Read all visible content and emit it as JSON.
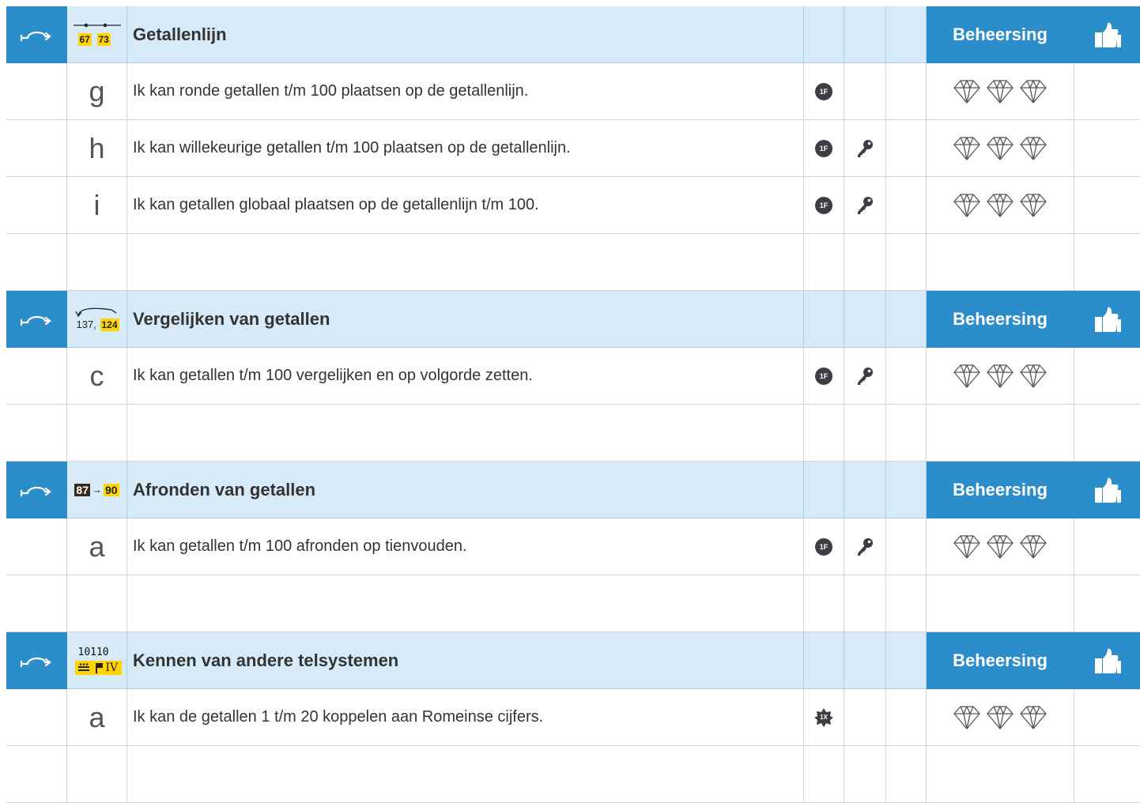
{
  "sections": [
    {
      "title": "Getallenlijn",
      "icon": "number-line-icon",
      "icon_numbers": [
        "67",
        "73"
      ],
      "mastery_label": "Beheersing",
      "rows": [
        {
          "letter": "g",
          "text": "Ik kan ronde getallen t/m 100 plaatsen op de getallenlijn.",
          "badge": "1F",
          "badge_type": "circle",
          "key": false
        },
        {
          "letter": "h",
          "text": "Ik kan willekeurige getallen t/m 100 plaatsen op de getallenlijn.",
          "badge": "1F",
          "badge_type": "circle",
          "key": true
        },
        {
          "letter": "i",
          "text": "Ik kan getallen globaal plaatsen op de getallenlijn t/m 100.",
          "badge": "1F",
          "badge_type": "circle",
          "key": true
        }
      ]
    },
    {
      "title": "Vergelijken van getallen",
      "icon": "compare-numbers-icon",
      "icon_numbers": [
        "137,",
        "124"
      ],
      "mastery_label": "Beheersing",
      "rows": [
        {
          "letter": "c",
          "text": "Ik kan getallen t/m 100 vergelijken en op volgorde zetten.",
          "badge": "1F",
          "badge_type": "circle",
          "key": true
        }
      ]
    },
    {
      "title": "Afronden van getallen",
      "icon": "rounding-icon",
      "icon_numbers": [
        "87",
        "→",
        "90"
      ],
      "mastery_label": "Beheersing",
      "rows": [
        {
          "letter": "a",
          "text": "Ik kan getallen t/m 100 afronden op tienvouden.",
          "badge": "1F",
          "badge_type": "circle",
          "key": true
        }
      ]
    },
    {
      "title": "Kennen van andere telsystemen",
      "icon": "number-systems-icon",
      "icon_numbers": [
        "10110",
        "IV"
      ],
      "mastery_label": "Beheersing",
      "rows": [
        {
          "letter": "a",
          "text": "Ik kan de getallen 1 t/m 20 koppelen aan Romeinse cijfers.",
          "badge": "1X",
          "badge_type": "star",
          "key": false
        }
      ]
    }
  ],
  "colors": {
    "header_blue": "#2b8ecb",
    "header_light": "#d6eaf8",
    "grid_line": "#cfd4dc",
    "badge_dark": "#3d3d46",
    "icon_yellow": "#ffd400"
  }
}
